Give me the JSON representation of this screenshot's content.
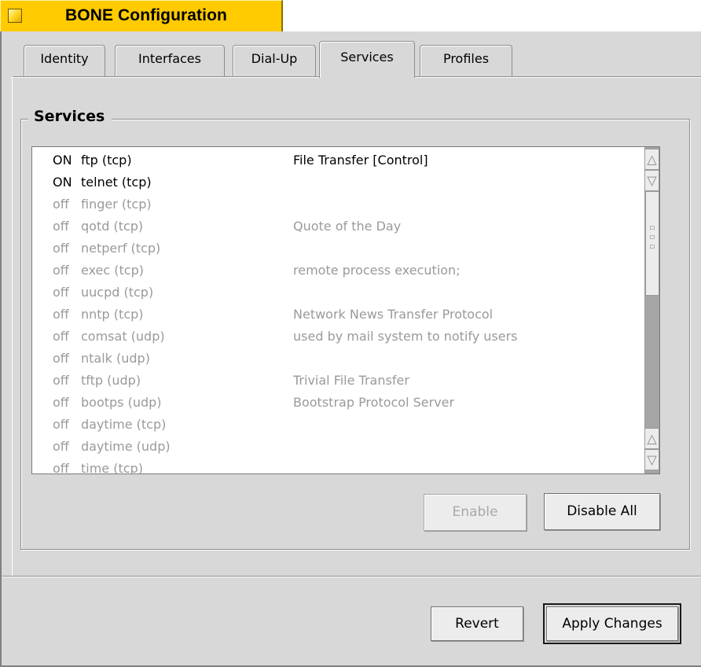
{
  "window": {
    "title": "BONE Configuration"
  },
  "tabs": [
    {
      "label": "Identity"
    },
    {
      "label": "Interfaces"
    },
    {
      "label": "Dial-Up"
    },
    {
      "label": "Services",
      "active": true
    },
    {
      "label": "Profiles"
    }
  ],
  "services_group": {
    "title": "Services",
    "rows": [
      {
        "status": "ON",
        "name": "ftp (tcp)",
        "desc": "File Transfer [Control]"
      },
      {
        "status": "ON",
        "name": "telnet (tcp)",
        "desc": ""
      },
      {
        "status": "off",
        "name": "finger (tcp)",
        "desc": ""
      },
      {
        "status": "off",
        "name": "qotd (tcp)",
        "desc": "Quote of the Day"
      },
      {
        "status": "off",
        "name": "netperf (tcp)",
        "desc": ""
      },
      {
        "status": "off",
        "name": "exec (tcp)",
        "desc": "remote process execution;"
      },
      {
        "status": "off",
        "name": "uucpd (tcp)",
        "desc": ""
      },
      {
        "status": "off",
        "name": "nntp (tcp)",
        "desc": "Network News Transfer Protocol"
      },
      {
        "status": "off",
        "name": "comsat (udp)",
        "desc": "used by mail system to notify users"
      },
      {
        "status": "off",
        "name": "ntalk (udp)",
        "desc": ""
      },
      {
        "status": "off",
        "name": "tftp (udp)",
        "desc": "Trivial File Transfer"
      },
      {
        "status": "off",
        "name": "bootps (udp)",
        "desc": "Bootstrap Protocol Server"
      },
      {
        "status": "off",
        "name": "daytime (tcp)",
        "desc": ""
      },
      {
        "status": "off",
        "name": "daytime (udp)",
        "desc": ""
      },
      {
        "status": "off",
        "name": "time (tcp)",
        "desc": ""
      }
    ],
    "enable_label": "Enable",
    "disable_all_label": "Disable All"
  },
  "footer": {
    "revert_label": "Revert",
    "apply_label": "Apply Changes"
  },
  "colors": {
    "title_tab": "#ffcb00",
    "panel": "#d8d8d8",
    "on_text": "#000000",
    "off_text": "#9a9a9a"
  }
}
